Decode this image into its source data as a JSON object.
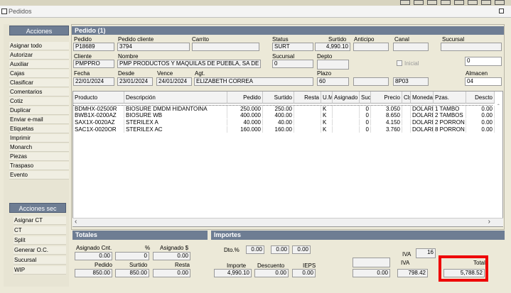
{
  "window": {
    "title": "Pedidos"
  },
  "left": {
    "acciones_title": "Acciones",
    "items": [
      "Asignar todo",
      "Autorizar",
      "Auxiliar",
      "Cajas",
      "Clasificar",
      "Comentarios",
      "Cotiz",
      "Duplicar",
      "Enviar e-mail",
      "Etiquetas",
      "Imprimir",
      "Monarch",
      "Piezas",
      "Traspaso",
      "Evento"
    ],
    "acciones_sec_title": "Acciones sec",
    "sec_items": [
      "Asignar CT",
      "CT",
      "Split",
      "Generar O.C.",
      "Sucursal",
      "WIP"
    ]
  },
  "pedido": {
    "header": "Pedido (1)",
    "labels": {
      "pedido": "Pedido",
      "pedido_cliente": "Pedido cliente",
      "carrito": "Carrito",
      "status": "Status",
      "surtido": "Surtido",
      "anticipo": "Anticipo",
      "canal": "Canal",
      "sucursal": "Sucursal",
      "cliente": "Cliente",
      "nombre": "Nombre",
      "sucursal2": "Sucursal",
      "depto": "Depto",
      "inicial": "Inicial",
      "fecha": "Fecha",
      "desde": "Desde",
      "vence": "Vence",
      "agt": "Agt.",
      "plazo": "Plazo",
      "almacen": "Almacen"
    },
    "values": {
      "pedido": "P18689",
      "pedido_cliente": "3794",
      "carrito": "",
      "status": "SURT",
      "surtido": "4,990.10",
      "anticipo": "",
      "canal": "",
      "sucursal": "",
      "cliente": "PMPPRO",
      "nombre": "PMP PRODUCTOS Y MAQUILAS DE PUEBLA, SA DE CV",
      "sucursal2": "0",
      "depto": "",
      "right_num": "0",
      "fecha": "22/01/2024",
      "desde": "23/01/2024",
      "vence": "24/01/2024",
      "agt": "ELIZABETH CORREA",
      "plazo": "60",
      "plazo2": "",
      "code": "8P03",
      "almacen": "04"
    }
  },
  "grid": {
    "columns": [
      "Producto",
      "Descripción",
      "Pedido",
      "Surtido",
      "Resta",
      "U.M.",
      "Asignado",
      "Suc",
      "Precio",
      "Cls",
      "Moneda",
      "Pzas.",
      "Descto"
    ],
    "rows": [
      [
        "BDMHX-02500R",
        "BIOSURE DMDM HIDANTOINA",
        "250.000",
        "250.00",
        "",
        "K",
        "",
        "0",
        "3.050",
        "",
        "DOLARE",
        "1 TAMBO",
        "0.00"
      ],
      [
        "BWB1X-0200AZ",
        "BIOSURE WB",
        "400.000",
        "400.00",
        "",
        "K",
        "",
        "0",
        "8.650",
        "",
        "DOLARE",
        "2 TAMBOS",
        "0.00"
      ],
      [
        "SAX1X-0020AZ",
        "STERILEX A",
        "40.000",
        "40.00",
        "",
        "K",
        "",
        "0",
        "4.150",
        "",
        "DOLARE",
        "2 PORRON",
        "0.00"
      ],
      [
        "SAC1X-0020OR",
        "STERILEX AC",
        "160.000",
        "160.00",
        "",
        "K",
        "",
        "0",
        "3.760",
        "",
        "DOLARE",
        "8 PORRON",
        "0.00"
      ]
    ]
  },
  "totales": {
    "header": "Totales",
    "asignado_cnt_label": "Asignado Cnt.",
    "pct_label": "%",
    "asignado_s_label": "Asignado $",
    "asignado_cnt": "0.00",
    "pct": "0",
    "asignado_s": "0.00",
    "pedido_label": "Pedido",
    "surtido_label": "Surtido",
    "resta_label": "Resta",
    "pedido": "850.00",
    "surtido": "850.00",
    "resta": "0.00"
  },
  "importes": {
    "header": "Importes",
    "dto_label": "Dto.%",
    "dto1": "0.00",
    "dto2": "0.00",
    "dto3": "0.00",
    "importe_label": "Importe",
    "descuento_label": "Descuento",
    "ieps_label": "IEPS",
    "importe": "4,990.10",
    "descuento": "0.00",
    "ieps": "0.00",
    "blank": "",
    "other": "0.00",
    "iva_rate_label": "IVA",
    "iva_rate": "16",
    "iva_label": "IVA",
    "iva": "798.42",
    "total_label": "Total",
    "total": "5,788.52"
  },
  "colors": {
    "accent": "#6e7d93",
    "highlight": "#ee0000"
  }
}
